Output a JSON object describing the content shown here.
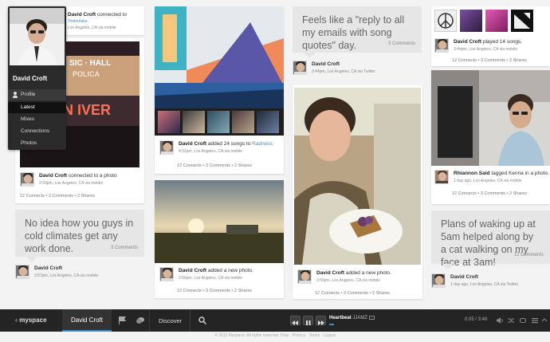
{
  "profile": {
    "name": "David Croft",
    "menu": [
      "Profile",
      "Latest",
      "Mixes",
      "Connections",
      "Photos"
    ]
  },
  "col1": {
    "card1": {
      "author": "David Croft",
      "action": "connected to a photo",
      "sub": "2:59pm, Los Angeles, CA via mobile",
      "stats": "12 Connects  •  3 Comments  •  2 Shares"
    },
    "top_partial": {
      "author": "David Croft",
      "action": "connected to",
      "link": "Timberlake.",
      "sub": "Los Angeles, CA via mobile"
    },
    "quote": {
      "text": "No idea how you guys in cold climates get any work done.",
      "comments": "3 Comments",
      "author": "David Croft",
      "sub": "2:57pm, Los Angeles, CA via mobile"
    }
  },
  "col2": {
    "card1": {
      "author": "David Croft",
      "action": "added 24 songs to",
      "link": "Radness.",
      "sub": "4:02pm, Los Angeles, CA via mobile",
      "stats": "12 Connects  •  3 Comments  •  2 Shares"
    },
    "card2": {
      "author": "David Croft",
      "action": "added a new photo.",
      "sub": "3:56pm, Los Angeles, CA via mobile",
      "stats": "12 Connects  •  3 Comments  •  2 Shares"
    }
  },
  "col3": {
    "quote": {
      "text": "Feels like a \"reply to all my emails with song quotes\" day.",
      "comments": "3 Comments",
      "author": "David Croft",
      "sub": "3:44pm, Los Angeles, CA via Twitter"
    },
    "card1": {
      "author": "David Croft",
      "action": "added a new photo.",
      "sub": "3:56pm, Los Angeles, CA via mobile",
      "stats": "12 Connects  •  3 Comments  •  2 Shares"
    }
  },
  "col4": {
    "songs": {
      "author": "David Croft",
      "action": "played 14 songs.",
      "sub": "3:44pm, Los Angeles, CA via mobile",
      "stats": "12 Connects  •  3 Comments  •  2 Shares"
    },
    "tagged": {
      "author": "Rhiannon Said",
      "action": "tagged Kenna in a photo.",
      "sub": "1 day ago, Los Angeles, CA via mobile",
      "stats": "12 Connects  •  3 Comments  •  2 Shares"
    },
    "quote": {
      "text": "Plans of waking up at 5am helped along by a cat walking on my face at 3am!",
      "comments": "12 Comments",
      "author": "David Croft",
      "sub": "1 day ago, Los Angeles, CA via Twitter"
    }
  },
  "bottombar": {
    "logo": "myspace",
    "user": "David Croft",
    "discover": "Discover",
    "track_title": "Heartbeat",
    "track_artist": "JJAMZ",
    "time": "0:05 / 3:49"
  },
  "footer": "© 2012 Myspace. All rights reserved. Help · Privacy · Terms · Logout"
}
